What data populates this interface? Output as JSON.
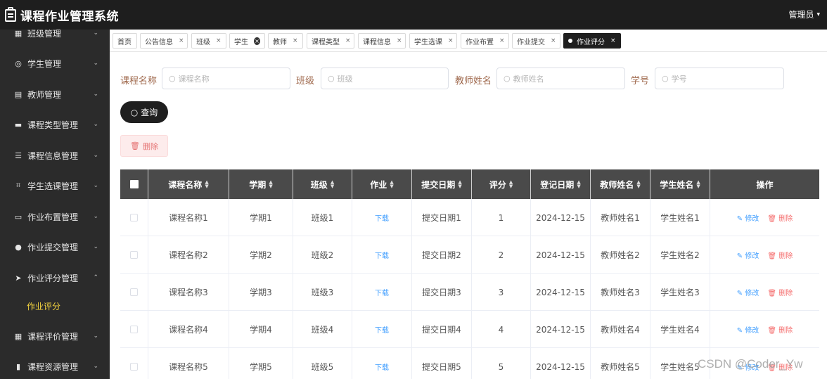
{
  "header": {
    "title": "课程作业管理系统",
    "user": "管理员"
  },
  "sidebar": {
    "items": [
      {
        "label": "班级管理",
        "icon": "grid-icon",
        "glyph": "▦",
        "arrow": "⌄"
      },
      {
        "label": "学生管理",
        "icon": "target-icon",
        "glyph": "◎",
        "arrow": "⌄"
      },
      {
        "label": "教师管理",
        "icon": "building-icon",
        "glyph": "▤",
        "arrow": "⌄"
      },
      {
        "label": "课程类型管理",
        "icon": "briefcase-icon",
        "glyph": "▬",
        "arrow": "⌄"
      },
      {
        "label": "课程信息管理",
        "icon": "menu-icon",
        "glyph": "☰",
        "arrow": "⌄"
      },
      {
        "label": "学生选课管理",
        "icon": "crop-icon",
        "glyph": "⌗",
        "arrow": "⌄"
      },
      {
        "label": "作业布置管理",
        "icon": "chat-icon",
        "glyph": "▭",
        "arrow": "⌄"
      },
      {
        "label": "作业提交管理",
        "icon": "user-icon",
        "glyph": "●",
        "arrow": "⌄"
      },
      {
        "label": "作业评分管理",
        "icon": "send-icon",
        "glyph": "➤",
        "arrow": "⌃"
      },
      {
        "label": "课程评价管理",
        "icon": "apps-icon",
        "glyph": "▦",
        "arrow": "⌄"
      },
      {
        "label": "课程资源管理",
        "icon": "chart-icon",
        "glyph": "▮",
        "arrow": "⌄"
      }
    ],
    "sub_active": "作业评分"
  },
  "tabs": [
    {
      "label": "首页"
    },
    {
      "label": "公告信息",
      "close": "×"
    },
    {
      "label": "班级",
      "close": "×"
    },
    {
      "label": "学生",
      "close": "×"
    },
    {
      "label": "教师",
      "close": "×"
    },
    {
      "label": "课程类型",
      "close": "×"
    },
    {
      "label": "课程信息",
      "close": "×"
    },
    {
      "label": "学生选课",
      "close": "×"
    },
    {
      "label": "作业布置",
      "close": "×"
    },
    {
      "label": "作业提交",
      "close": "×"
    },
    {
      "label": "作业评分",
      "close": "×"
    }
  ],
  "search": {
    "fields": [
      {
        "label": "课程名称",
        "placeholder": "课程名称"
      },
      {
        "label": "班级",
        "placeholder": "班级"
      },
      {
        "label": "教师姓名",
        "placeholder": "教师姓名"
      },
      {
        "label": "学号",
        "placeholder": "学号"
      }
    ],
    "query_label": "查询",
    "delete_label": "删除"
  },
  "table": {
    "columns": [
      "课程名称",
      "学期",
      "班级",
      "作业",
      "提交日期",
      "评分",
      "登记日期",
      "教师姓名",
      "学生姓名",
      "操作"
    ],
    "edit_label": "修改",
    "delete_label": "删除",
    "rows": [
      {
        "course": "课程名称1",
        "term": "学期1",
        "class": "班级1",
        "homework": "下载",
        "submit": "提交日期1",
        "score": "1",
        "reg": "2024-12-15",
        "teacher": "教师姓名1",
        "student": "学生姓名1"
      },
      {
        "course": "课程名称2",
        "term": "学期2",
        "class": "班级2",
        "homework": "下载",
        "submit": "提交日期2",
        "score": "2",
        "reg": "2024-12-15",
        "teacher": "教师姓名2",
        "student": "学生姓名2"
      },
      {
        "course": "课程名称3",
        "term": "学期3",
        "class": "班级3",
        "homework": "下载",
        "submit": "提交日期3",
        "score": "3",
        "reg": "2024-12-15",
        "teacher": "教师姓名3",
        "student": "学生姓名3"
      },
      {
        "course": "课程名称4",
        "term": "学期4",
        "class": "班级4",
        "homework": "下载",
        "submit": "提交日期4",
        "score": "4",
        "reg": "2024-12-15",
        "teacher": "教师姓名4",
        "student": "学生姓名4"
      },
      {
        "course": "课程名称5",
        "term": "学期5",
        "class": "班级5",
        "homework": "下载",
        "submit": "提交日期5",
        "score": "5",
        "reg": "2024-12-15",
        "teacher": "教师姓名5",
        "student": "学生姓名5"
      }
    ]
  },
  "watermark": "CSDN @Coder_Yw"
}
